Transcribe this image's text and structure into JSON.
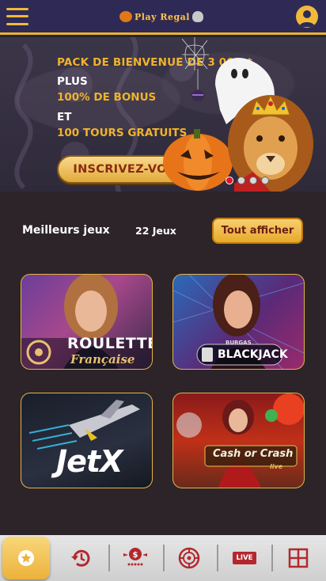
{
  "header": {
    "logo_text": "Play Regal",
    "menu_icon": "hamburger-menu-icon",
    "user_icon": "user-account-icon"
  },
  "banner": {
    "line1": "PACK DE BIENVENUE DE 3 000 $",
    "line2": "PLUS",
    "line3": "100% DE BONUS",
    "line4": "ET",
    "line5": "100 TOURS GRATUITS",
    "cta_label": "INSCRIVEZ-VOUS",
    "slides_total": 4,
    "active_slide": 1
  },
  "top_games": {
    "title": "Meilleurs jeux",
    "count": "22 Jeux",
    "show_all_label": "Tout afficher",
    "games": [
      {
        "name_line1": "ROULETTE",
        "name_line2": "Française"
      },
      {
        "name_line1": "BURGAS",
        "name_line2": "BLACKJACK"
      },
      {
        "name_line1": "JetX"
      },
      {
        "name_line1": "Cash or Crash",
        "name_line2": "live"
      }
    ]
  },
  "bottom_nav": {
    "items": [
      {
        "icon": "star-favorites-icon",
        "active": true
      },
      {
        "icon": "history-clock-icon"
      },
      {
        "icon": "dollar-stars-icon"
      },
      {
        "icon": "roulette-wheel-icon"
      },
      {
        "icon": "live-badge-icon",
        "label": "LIVE"
      },
      {
        "icon": "grid-icon"
      }
    ]
  },
  "colors": {
    "header_bg": "#2e2a55",
    "accent_gold": "#f0b93a",
    "banner_gold_text": "#f0b32a",
    "page_bg": "#2c2429",
    "live_red": "#b3282e"
  }
}
